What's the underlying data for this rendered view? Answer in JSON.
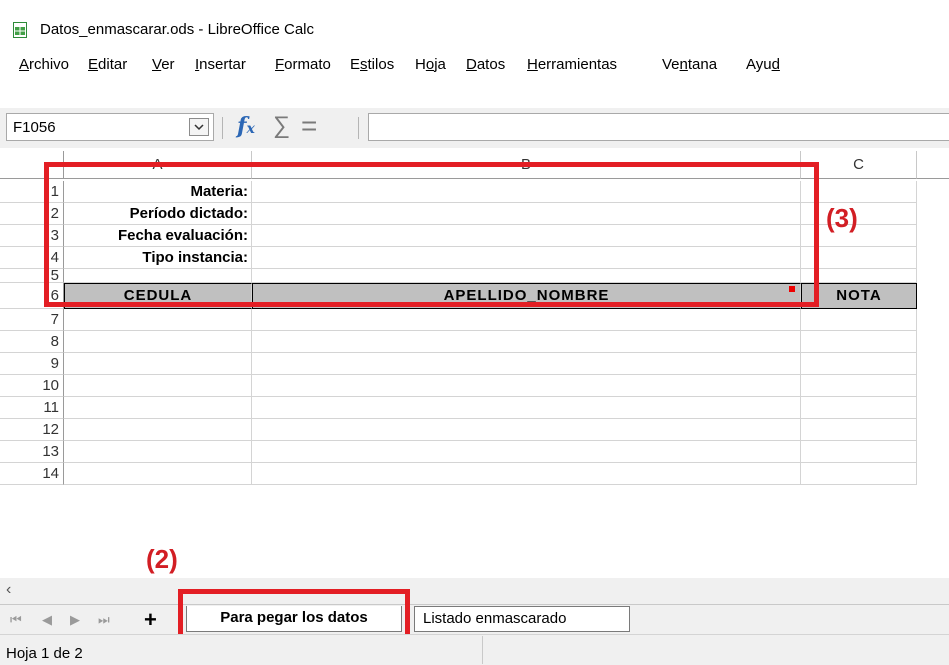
{
  "window": {
    "title": "Datos_enmascarar.ods - LibreOffice Calc"
  },
  "menu": [
    {
      "label": "Archivo",
      "ul": "A",
      "rest": "rchivo"
    },
    {
      "label": "Editar",
      "ul": "E",
      "rest": "ditar"
    },
    {
      "label": "Ver",
      "ul": "V",
      "rest": "er"
    },
    {
      "label": "Insertar",
      "ul": "I",
      "rest": "nsertar"
    },
    {
      "label": "Formato",
      "ul": "F",
      "rest": "ormato"
    },
    {
      "label": "Estilos",
      "pre": "E",
      "ul": "s",
      "rest": "tilos"
    },
    {
      "label": "Hoja",
      "pre": "H",
      "ul": "o",
      "rest": "ja"
    },
    {
      "label": "Datos",
      "ul": "D",
      "rest": "atos"
    },
    {
      "label": "Herramientas",
      "ul": "H",
      "rest": "erramientas"
    },
    {
      "label": "Ventana",
      "pre": "Ve",
      "ul": "n",
      "rest": "tana"
    },
    {
      "label": "Ayuda",
      "pre": "Ayu",
      "ul": "d",
      "rest": ""
    }
  ],
  "formula_bar": {
    "name_box": "F1056",
    "formula": ""
  },
  "columns": [
    "A",
    "B",
    "C"
  ],
  "rows": [
    "1",
    "2",
    "3",
    "4",
    "5",
    "6",
    "7",
    "8",
    "9",
    "10",
    "11",
    "12",
    "13",
    "14"
  ],
  "cells": {
    "a1": "Materia:",
    "a2": "Período dictado:",
    "a3": "Fecha evaluación:",
    "a4": "Tipo instancia:",
    "a6": "CEDULA",
    "b6": "APELLIDO_NOMBRE",
    "c6": "NOTA"
  },
  "annotations": {
    "a2": "(2)",
    "a3": "(3)"
  },
  "sheets": {
    "active": "Para pegar los datos",
    "other": "Listado enmascarado"
  },
  "status": {
    "sheet": "Hoja 1 de 2"
  },
  "colors": {
    "annotation": "#e31e24",
    "header_fill": "#c0c0c0",
    "fx": "#2c67b5"
  }
}
